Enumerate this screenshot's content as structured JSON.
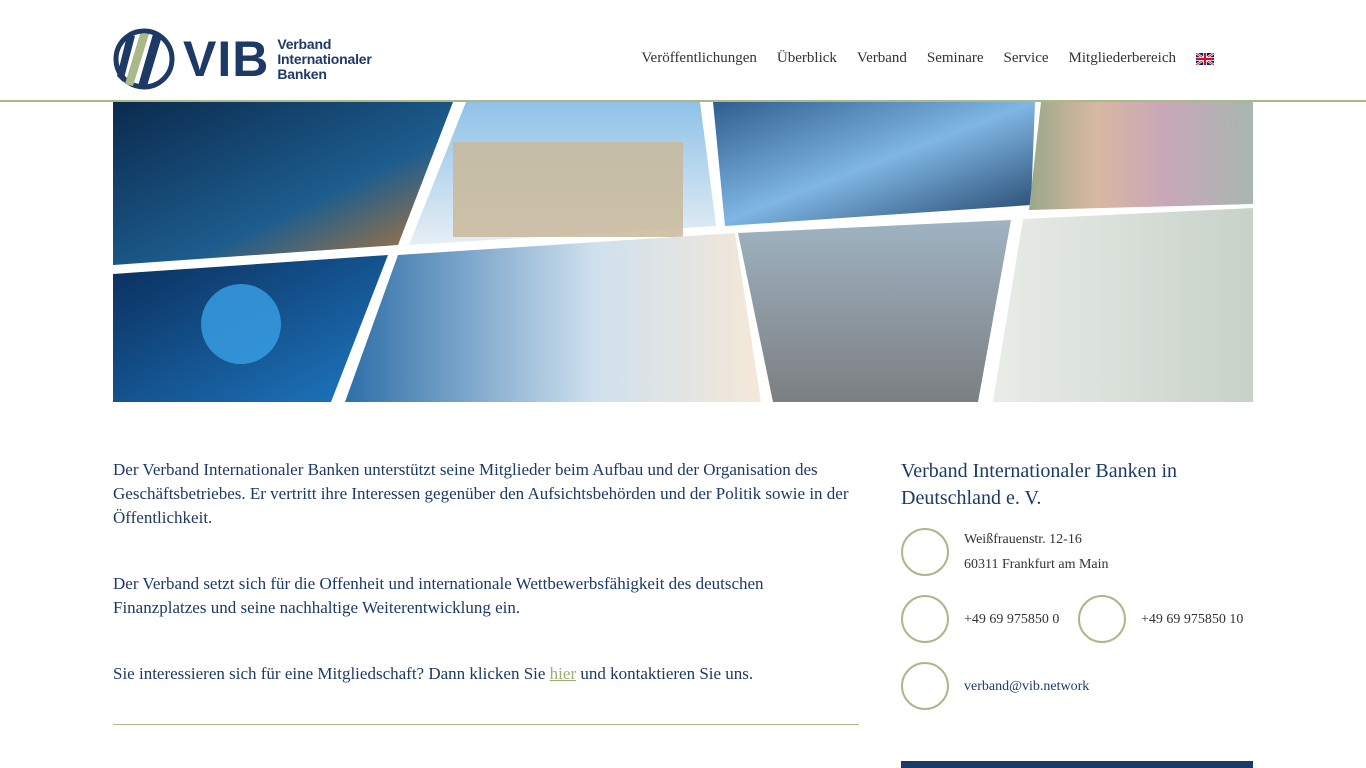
{
  "logo": {
    "abbr": "VIB",
    "line1": "Verband",
    "line2": "Internationaler",
    "line3": "Banken"
  },
  "nav": {
    "items": [
      "Veröffentlichungen",
      "Überblick",
      "Verband",
      "Seminare",
      "Service",
      "Mitgliederbereich"
    ],
    "language_icon": "uk-flag-icon"
  },
  "main": {
    "p1": "Der Verband Internationaler Banken unterstützt seine Mitglieder beim Aufbau und der Organisation des Geschäftsbetriebes. Er vertritt ihre Interessen gegenüber den Aufsichtsbehörden und der Politik sowie in der Öffentlichkeit.",
    "p2": "Der Verband setzt sich für die Offenheit und internationale Wettbewerbsfähigkeit des deutschen Finanzplatzes und seine nachhaltige Weiterentwicklung ein.",
    "p3_before": "Sie interessieren sich für eine Mitgliedschaft? Dann klicken Sie ",
    "p3_link": "hier",
    "p3_after": " und kontaktieren Sie uns."
  },
  "sidebar": {
    "title": "Verband Internationaler Banken in Deutschland e. V.",
    "address_line1": "Weißfrauenstr. 12-16",
    "address_line2": "60311 Frankfurt am Main",
    "phone": "+49 69 975850 0",
    "fax": "+49 69 975850 10",
    "email": "verband@vib.network"
  },
  "colors": {
    "brand_blue": "#1d3a66",
    "accent_green": "#a9b98a"
  }
}
